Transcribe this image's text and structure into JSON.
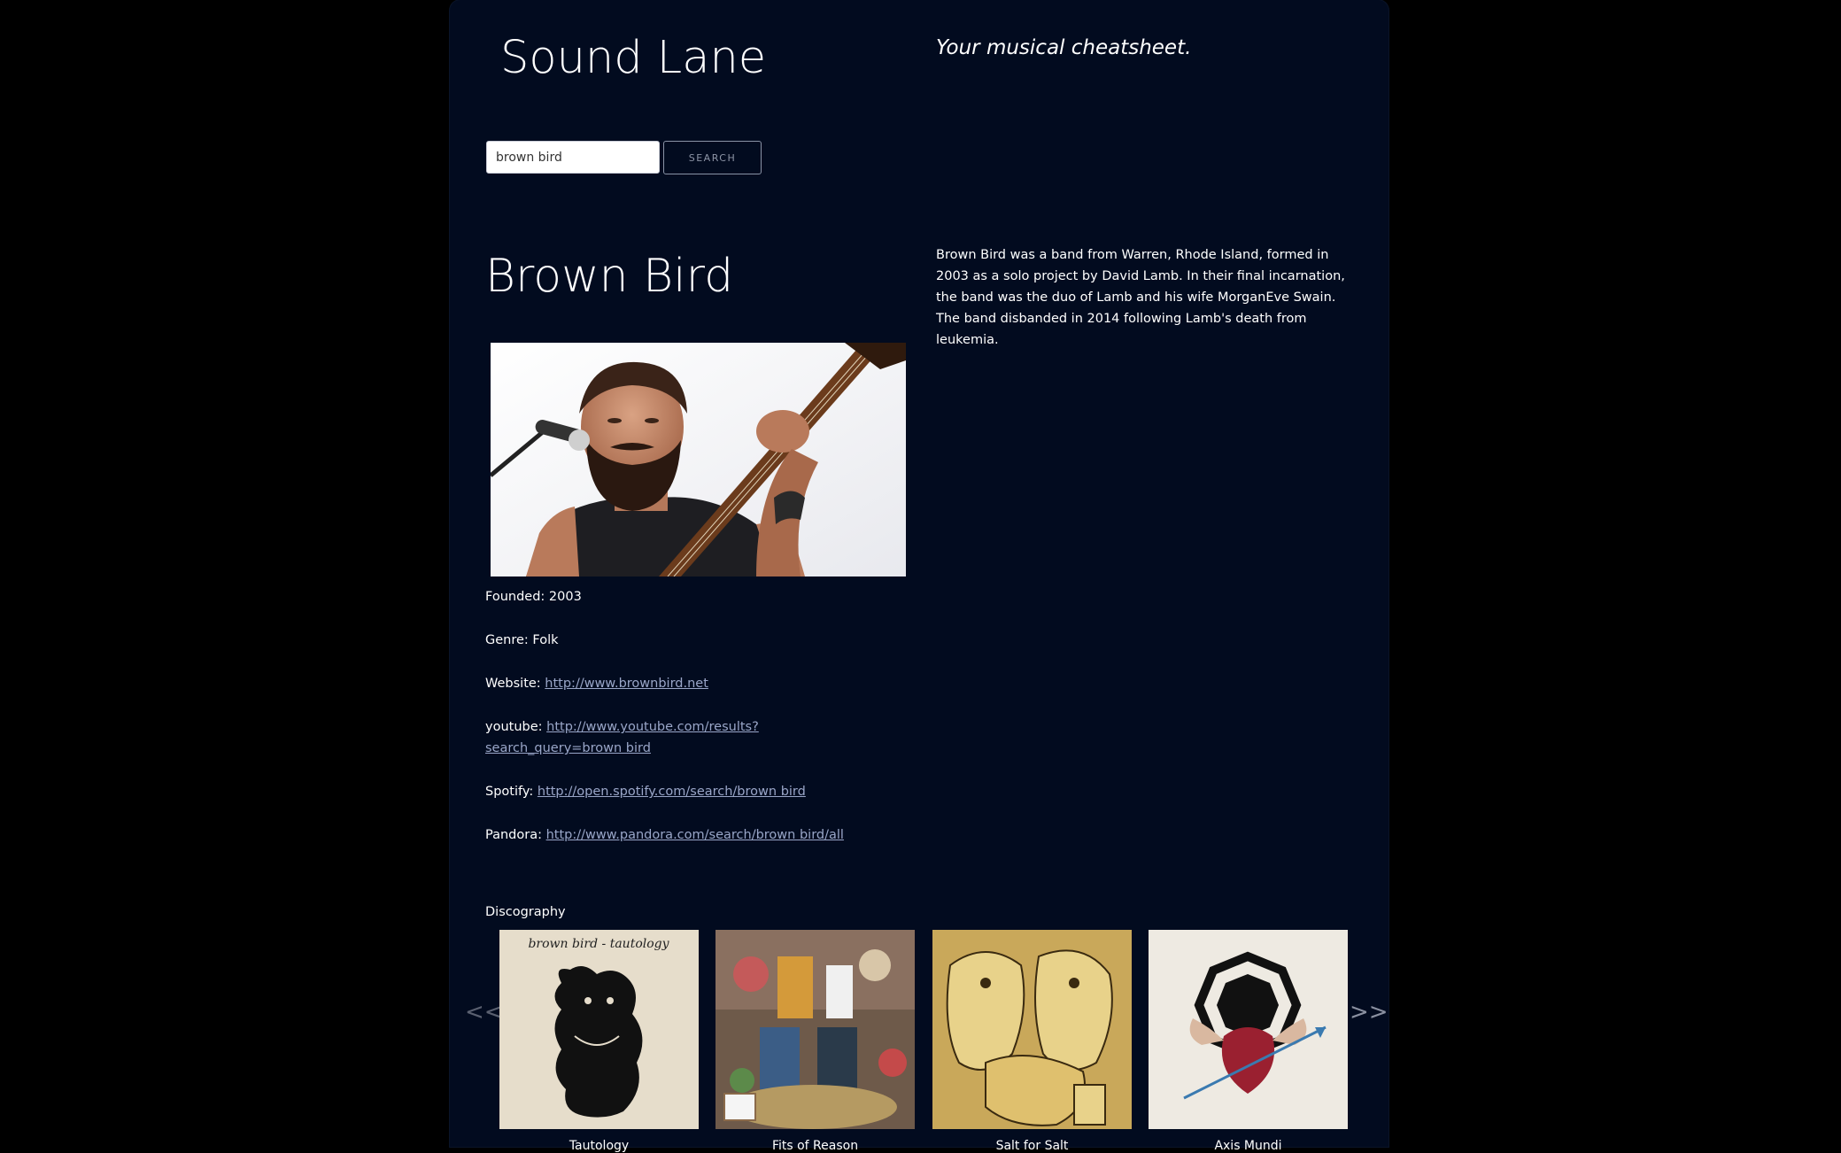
{
  "header": {
    "site_title": "Sound Lane",
    "tagline": "Your musical cheatsheet."
  },
  "search": {
    "value": "brown bird",
    "button_label": "SEARCH"
  },
  "artist": {
    "name": "Brown Bird",
    "bio": "Brown Bird was a band from Warren, Rhode Island, formed in 2003 as a solo project by David Lamb. In their final incarnation, the band was the duo of Lamb and his wife MorganEve Swain. The band disbanded in 2014 following Lamb's death from leukemia.",
    "facts": {
      "founded_label": "Founded:",
      "founded_value": "2003",
      "genre_label": "Genre:",
      "genre_value": "Folk",
      "website_label": "Website:",
      "website_url": "http://www.brownbird.net",
      "youtube_label": "youtube:",
      "youtube_url": "http://www.youtube.com/results?search_query=brown bird",
      "spotify_label": "Spotify:",
      "spotify_url": "http://open.spotify.com/search/brown bird",
      "pandora_label": "Pandora:",
      "pandora_url": "http://www.pandora.com/search/brown bird/all"
    }
  },
  "discography": {
    "label": "Discography",
    "prev_arrow": "<<",
    "next_arrow": ">>",
    "albums": [
      {
        "cover_text": "brown bird - tautology",
        "title": "Tautology"
      },
      {
        "cover_text": "",
        "title": "Fits of Reason"
      },
      {
        "cover_text": "",
        "title": "Salt for Salt"
      },
      {
        "cover_text": "",
        "title": "Axis Mundi"
      }
    ]
  },
  "colors": {
    "page_background": "#000000",
    "panel_background": "#020b1f",
    "text": "#ffffff",
    "link": "#9aa6c8",
    "muted": "#8d95a6"
  }
}
